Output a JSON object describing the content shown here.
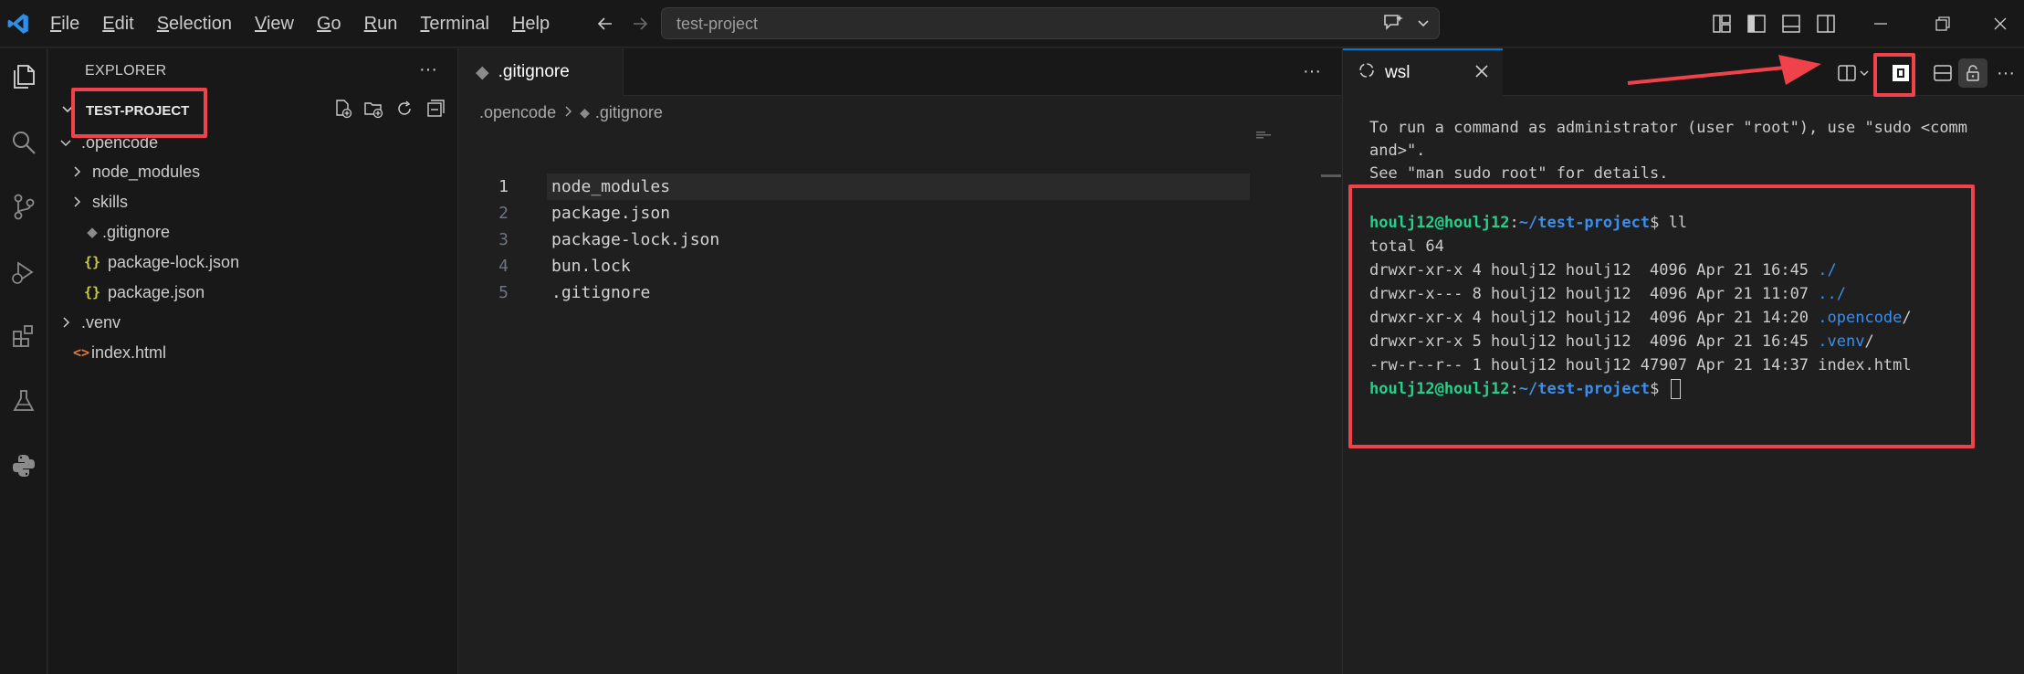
{
  "menu": {
    "items": [
      "File",
      "Edit",
      "Selection",
      "View",
      "Go",
      "Run",
      "Terminal",
      "Help"
    ],
    "underline": [
      "F",
      "E",
      "S",
      "V",
      "G",
      "R",
      "T",
      "H"
    ]
  },
  "command_center": {
    "text": "test-project"
  },
  "explorer": {
    "header": "EXPLORER",
    "project": "TEST-PROJECT",
    "tree": [
      {
        "label": ".opencode",
        "kind": "folder-open",
        "depth": 0
      },
      {
        "label": "node_modules",
        "kind": "folder",
        "depth": 1
      },
      {
        "label": "skills",
        "kind": "folder",
        "depth": 1
      },
      {
        "label": ".gitignore",
        "kind": "git",
        "depth": 1
      },
      {
        "label": "package-lock.json",
        "kind": "json",
        "depth": 1
      },
      {
        "label": "package.json",
        "kind": "json",
        "depth": 1
      },
      {
        "label": ".venv",
        "kind": "folder",
        "depth": 0
      },
      {
        "label": "index.html",
        "kind": "html",
        "depth": 0
      }
    ]
  },
  "editor": {
    "tab_label": ".gitignore",
    "breadcrumb": [
      ".opencode",
      ".gitignore"
    ],
    "lines": [
      {
        "num": "1",
        "text": "node_modules"
      },
      {
        "num": "2",
        "text": "package.json"
      },
      {
        "num": "3",
        "text": "package-lock.json"
      },
      {
        "num": "4",
        "text": "bun.lock"
      },
      {
        "num": "5",
        "text": ".gitignore"
      }
    ]
  },
  "terminal": {
    "tab_label": "wsl",
    "intro": [
      "To run a command as administrator (user \"root\"), use \"sudo <comm",
      "and>\".",
      "See \"man sudo root\" for details."
    ],
    "prompt_user": "houlj12@houlj12",
    "prompt_sep": ":",
    "prompt_path": "~/test-project",
    "prompt_end": "$ ",
    "command": "ll",
    "total": "total 64",
    "listing": [
      {
        "meta": "drwxr-xr-x 4 houlj12 houlj12  4096 Apr 21 16:45 ",
        "name": "./",
        "dir": true,
        "suffix": ""
      },
      {
        "meta": "drwxr-x--- 8 houlj12 houlj12  4096 Apr 21 11:07 ",
        "name": "../",
        "dir": true,
        "suffix": ""
      },
      {
        "meta": "drwxr-xr-x 4 houlj12 houlj12  4096 Apr 21 14:20 ",
        "name": ".opencode",
        "dir": true,
        "suffix": "/"
      },
      {
        "meta": "drwxr-xr-x 5 houlj12 houlj12  4096 Apr 21 16:45 ",
        "name": ".venv",
        "dir": true,
        "suffix": "/"
      },
      {
        "meta": "-rw-r--r-- 1 houlj12 houlj12 47907 Apr 21 14:37 ",
        "name": "index.html",
        "dir": false,
        "suffix": ""
      }
    ]
  },
  "colors": {
    "annotation": "#f0424a",
    "accent": "#0078d4",
    "prompt_user": "#23d18b",
    "prompt_path": "#3b8eea"
  }
}
